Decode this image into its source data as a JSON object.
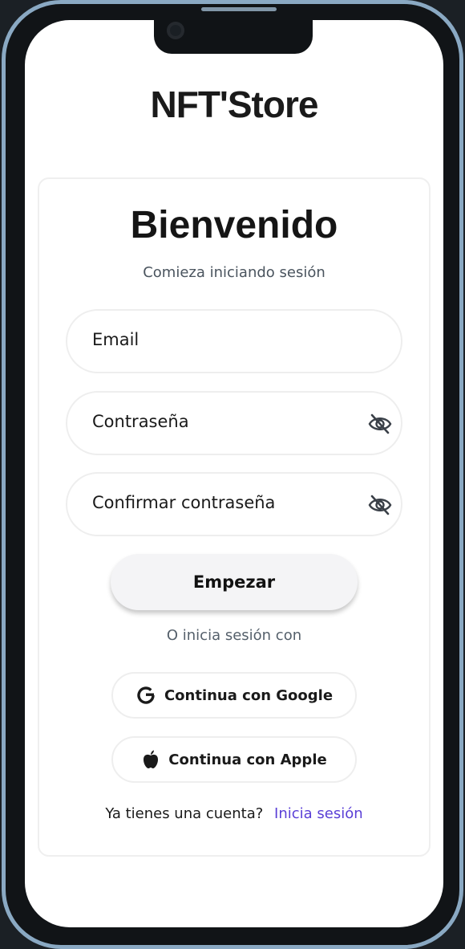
{
  "app": {
    "title": "NFT'Store"
  },
  "card": {
    "heading": "Bienvenido",
    "subtitle": "Comieza iniciando sesión"
  },
  "form": {
    "email_placeholder": "Email",
    "password_placeholder": "Contraseña",
    "confirm_password_placeholder": "Confirmar contraseña",
    "password_icon": "eye-off-icon",
    "confirm_password_icon": "eye-off-icon",
    "submit_label": "Empezar"
  },
  "social": {
    "divider_text": "O inicia sesión con",
    "google_label": "Continua con Google",
    "google_icon": "google-icon",
    "apple_label": "Continua con Apple",
    "apple_icon": "apple-icon"
  },
  "footer": {
    "prompt": "Ya tienes una cuenta?",
    "login_link": "Inicia sesión",
    "link_color": "#5a3fd6"
  }
}
